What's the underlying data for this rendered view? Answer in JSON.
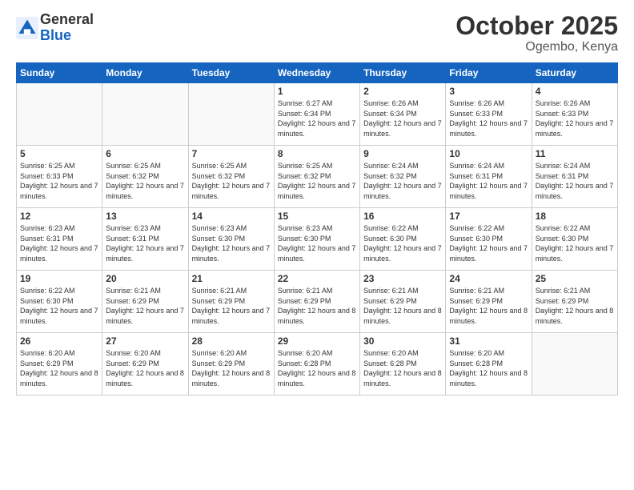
{
  "logo": {
    "general": "General",
    "blue": "Blue"
  },
  "header": {
    "month": "October 2025",
    "location": "Ogembo, Kenya"
  },
  "weekdays": [
    "Sunday",
    "Monday",
    "Tuesday",
    "Wednesday",
    "Thursday",
    "Friday",
    "Saturday"
  ],
  "weeks": [
    [
      {
        "day": "",
        "sunrise": "",
        "sunset": "",
        "daylight": ""
      },
      {
        "day": "",
        "sunrise": "",
        "sunset": "",
        "daylight": ""
      },
      {
        "day": "",
        "sunrise": "",
        "sunset": "",
        "daylight": ""
      },
      {
        "day": "1",
        "sunrise": "Sunrise: 6:27 AM",
        "sunset": "Sunset: 6:34 PM",
        "daylight": "Daylight: 12 hours and 7 minutes."
      },
      {
        "day": "2",
        "sunrise": "Sunrise: 6:26 AM",
        "sunset": "Sunset: 6:34 PM",
        "daylight": "Daylight: 12 hours and 7 minutes."
      },
      {
        "day": "3",
        "sunrise": "Sunrise: 6:26 AM",
        "sunset": "Sunset: 6:33 PM",
        "daylight": "Daylight: 12 hours and 7 minutes."
      },
      {
        "day": "4",
        "sunrise": "Sunrise: 6:26 AM",
        "sunset": "Sunset: 6:33 PM",
        "daylight": "Daylight: 12 hours and 7 minutes."
      }
    ],
    [
      {
        "day": "5",
        "sunrise": "Sunrise: 6:25 AM",
        "sunset": "Sunset: 6:33 PM",
        "daylight": "Daylight: 12 hours and 7 minutes."
      },
      {
        "day": "6",
        "sunrise": "Sunrise: 6:25 AM",
        "sunset": "Sunset: 6:32 PM",
        "daylight": "Daylight: 12 hours and 7 minutes."
      },
      {
        "day": "7",
        "sunrise": "Sunrise: 6:25 AM",
        "sunset": "Sunset: 6:32 PM",
        "daylight": "Daylight: 12 hours and 7 minutes."
      },
      {
        "day": "8",
        "sunrise": "Sunrise: 6:25 AM",
        "sunset": "Sunset: 6:32 PM",
        "daylight": "Daylight: 12 hours and 7 minutes."
      },
      {
        "day": "9",
        "sunrise": "Sunrise: 6:24 AM",
        "sunset": "Sunset: 6:32 PM",
        "daylight": "Daylight: 12 hours and 7 minutes."
      },
      {
        "day": "10",
        "sunrise": "Sunrise: 6:24 AM",
        "sunset": "Sunset: 6:31 PM",
        "daylight": "Daylight: 12 hours and 7 minutes."
      },
      {
        "day": "11",
        "sunrise": "Sunrise: 6:24 AM",
        "sunset": "Sunset: 6:31 PM",
        "daylight": "Daylight: 12 hours and 7 minutes."
      }
    ],
    [
      {
        "day": "12",
        "sunrise": "Sunrise: 6:23 AM",
        "sunset": "Sunset: 6:31 PM",
        "daylight": "Daylight: 12 hours and 7 minutes."
      },
      {
        "day": "13",
        "sunrise": "Sunrise: 6:23 AM",
        "sunset": "Sunset: 6:31 PM",
        "daylight": "Daylight: 12 hours and 7 minutes."
      },
      {
        "day": "14",
        "sunrise": "Sunrise: 6:23 AM",
        "sunset": "Sunset: 6:30 PM",
        "daylight": "Daylight: 12 hours and 7 minutes."
      },
      {
        "day": "15",
        "sunrise": "Sunrise: 6:23 AM",
        "sunset": "Sunset: 6:30 PM",
        "daylight": "Daylight: 12 hours and 7 minutes."
      },
      {
        "day": "16",
        "sunrise": "Sunrise: 6:22 AM",
        "sunset": "Sunset: 6:30 PM",
        "daylight": "Daylight: 12 hours and 7 minutes."
      },
      {
        "day": "17",
        "sunrise": "Sunrise: 6:22 AM",
        "sunset": "Sunset: 6:30 PM",
        "daylight": "Daylight: 12 hours and 7 minutes."
      },
      {
        "day": "18",
        "sunrise": "Sunrise: 6:22 AM",
        "sunset": "Sunset: 6:30 PM",
        "daylight": "Daylight: 12 hours and 7 minutes."
      }
    ],
    [
      {
        "day": "19",
        "sunrise": "Sunrise: 6:22 AM",
        "sunset": "Sunset: 6:30 PM",
        "daylight": "Daylight: 12 hours and 7 minutes."
      },
      {
        "day": "20",
        "sunrise": "Sunrise: 6:21 AM",
        "sunset": "Sunset: 6:29 PM",
        "daylight": "Daylight: 12 hours and 7 minutes."
      },
      {
        "day": "21",
        "sunrise": "Sunrise: 6:21 AM",
        "sunset": "Sunset: 6:29 PM",
        "daylight": "Daylight: 12 hours and 7 minutes."
      },
      {
        "day": "22",
        "sunrise": "Sunrise: 6:21 AM",
        "sunset": "Sunset: 6:29 PM",
        "daylight": "Daylight: 12 hours and 8 minutes."
      },
      {
        "day": "23",
        "sunrise": "Sunrise: 6:21 AM",
        "sunset": "Sunset: 6:29 PM",
        "daylight": "Daylight: 12 hours and 8 minutes."
      },
      {
        "day": "24",
        "sunrise": "Sunrise: 6:21 AM",
        "sunset": "Sunset: 6:29 PM",
        "daylight": "Daylight: 12 hours and 8 minutes."
      },
      {
        "day": "25",
        "sunrise": "Sunrise: 6:21 AM",
        "sunset": "Sunset: 6:29 PM",
        "daylight": "Daylight: 12 hours and 8 minutes."
      }
    ],
    [
      {
        "day": "26",
        "sunrise": "Sunrise: 6:20 AM",
        "sunset": "Sunset: 6:29 PM",
        "daylight": "Daylight: 12 hours and 8 minutes."
      },
      {
        "day": "27",
        "sunrise": "Sunrise: 6:20 AM",
        "sunset": "Sunset: 6:29 PM",
        "daylight": "Daylight: 12 hours and 8 minutes."
      },
      {
        "day": "28",
        "sunrise": "Sunrise: 6:20 AM",
        "sunset": "Sunset: 6:29 PM",
        "daylight": "Daylight: 12 hours and 8 minutes."
      },
      {
        "day": "29",
        "sunrise": "Sunrise: 6:20 AM",
        "sunset": "Sunset: 6:28 PM",
        "daylight": "Daylight: 12 hours and 8 minutes."
      },
      {
        "day": "30",
        "sunrise": "Sunrise: 6:20 AM",
        "sunset": "Sunset: 6:28 PM",
        "daylight": "Daylight: 12 hours and 8 minutes."
      },
      {
        "day": "31",
        "sunrise": "Sunrise: 6:20 AM",
        "sunset": "Sunset: 6:28 PM",
        "daylight": "Daylight: 12 hours and 8 minutes."
      },
      {
        "day": "",
        "sunrise": "",
        "sunset": "",
        "daylight": ""
      }
    ]
  ]
}
